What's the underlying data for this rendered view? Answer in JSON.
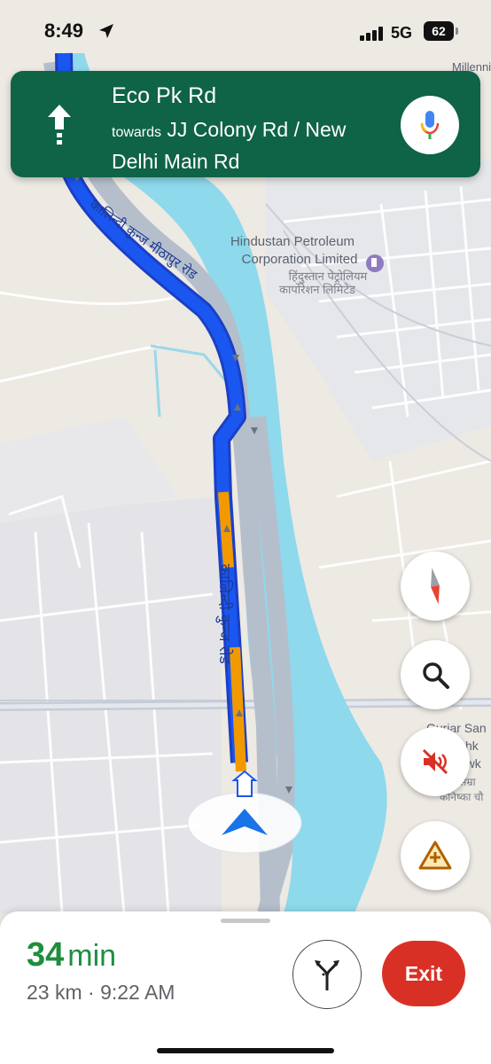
{
  "status_bar": {
    "time": "8:49",
    "network": "5G",
    "battery": "62"
  },
  "navigation": {
    "street": "Eco Pk Rd",
    "towards_label": "towards",
    "destination_roads": "JJ Colony Rd / New Delhi Main Rd",
    "direction_icon": "straight-arrow-icon"
  },
  "map": {
    "poi_name_en_line1": "Hindustan Petroleum",
    "poi_name_en_line2": "Corporation Limited",
    "poi_name_hi_line1": "हिंदुस्तान पेट्रोलियम",
    "poi_name_hi_line2": "कार्पोरेशन लिमिटेड",
    "road_label_top": "कालिन्दी कुन्ज मीठापुर रोड",
    "road_label_center": "कालिन्दी कुन्ज रोड",
    "edge_label_top": "Millenni",
    "edge_label_right_1": "Gurjar San",
    "edge_label_right_2": "Kanishk",
    "edge_label_right_3": "Chowk",
    "edge_label_right_4": "र सम्रा",
    "edge_label_right_5": "कनिष्का चौ",
    "colors": {
      "route_blue": "#1a56f0",
      "traffic_orange": "#f29900",
      "river": "#8ed9ec",
      "nav_green": "#0f6346",
      "eta_green": "#1e8e3e",
      "exit_red": "#d93025"
    }
  },
  "controls": {
    "compass": "compass-icon",
    "search": "search-icon",
    "mute": "volume-off-icon",
    "report": "report-incident-icon"
  },
  "trip": {
    "eta_value": "34",
    "eta_unit": "min",
    "summary": "23 km · 9:22 AM",
    "alternate_routes_icon": "alternate-routes-icon",
    "exit_label": "Exit"
  }
}
